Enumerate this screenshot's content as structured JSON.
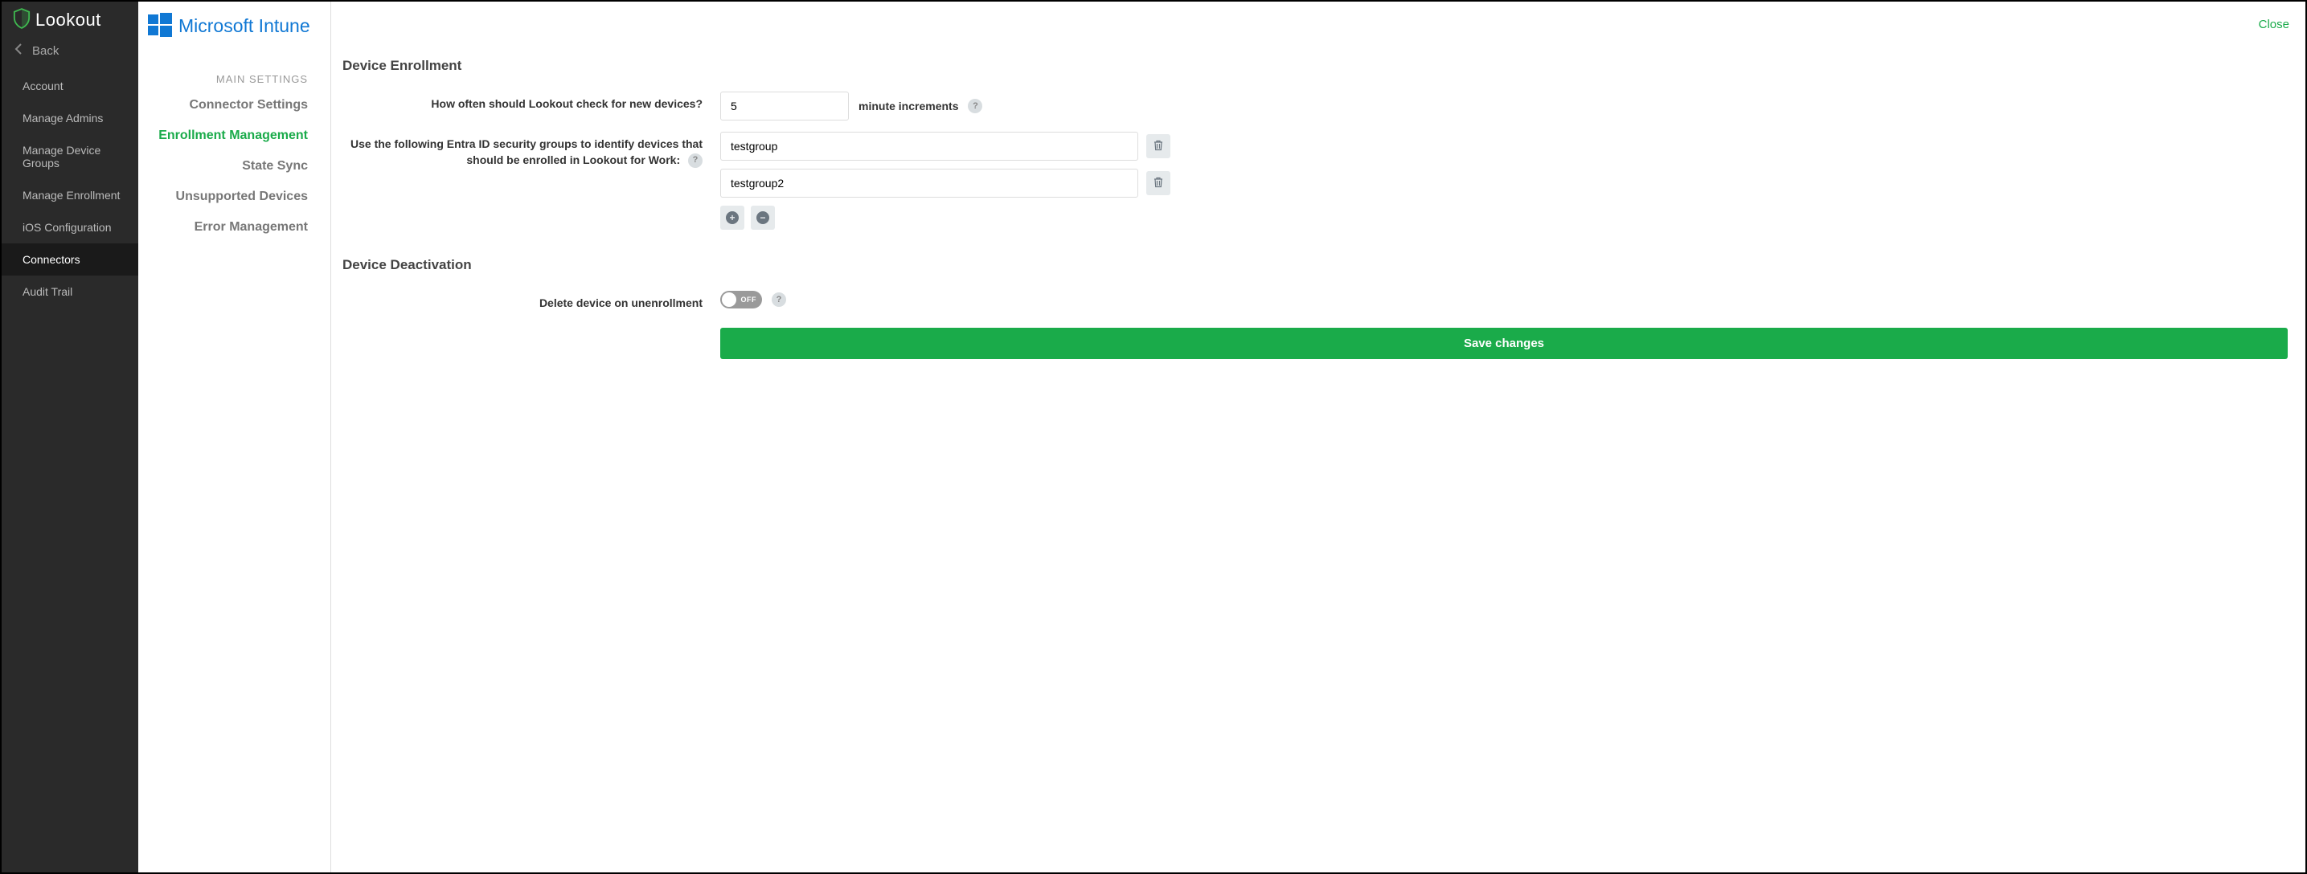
{
  "brand": "Lookout",
  "sidebar": {
    "back": "Back",
    "items": [
      {
        "label": "Account"
      },
      {
        "label": "Manage Admins"
      },
      {
        "label": "Manage Device Groups"
      },
      {
        "label": "Manage Enrollment"
      },
      {
        "label": "iOS Configuration"
      },
      {
        "label": "Connectors",
        "active": true
      },
      {
        "label": "Audit Trail"
      }
    ]
  },
  "secondary": {
    "connector_name": "Microsoft Intune",
    "heading": "MAIN SETTINGS",
    "items": [
      {
        "label": "Connector Settings"
      },
      {
        "label": "Enrollment Management",
        "active": true
      },
      {
        "label": "State Sync"
      },
      {
        "label": "Unsupported Devices"
      },
      {
        "label": "Error Management"
      }
    ]
  },
  "main": {
    "close": "Close",
    "enrollment_title": "Device Enrollment",
    "check_label": "How often should Lookout check for new devices?",
    "check_value": "5",
    "check_suffix": "minute increments",
    "groups_label_pre": "Use the following ",
    "groups_label_bold": "Entra ID",
    "groups_label_post": " security groups to identify devices that should be enrolled in Lookout for Work:",
    "groups": [
      "testgroup",
      "testgroup2"
    ],
    "deactivation_title": "Device Deactivation",
    "delete_label": "Delete device on unenrollment",
    "toggle_text": "OFF",
    "save": "Save changes",
    "help_glyph": "?"
  }
}
